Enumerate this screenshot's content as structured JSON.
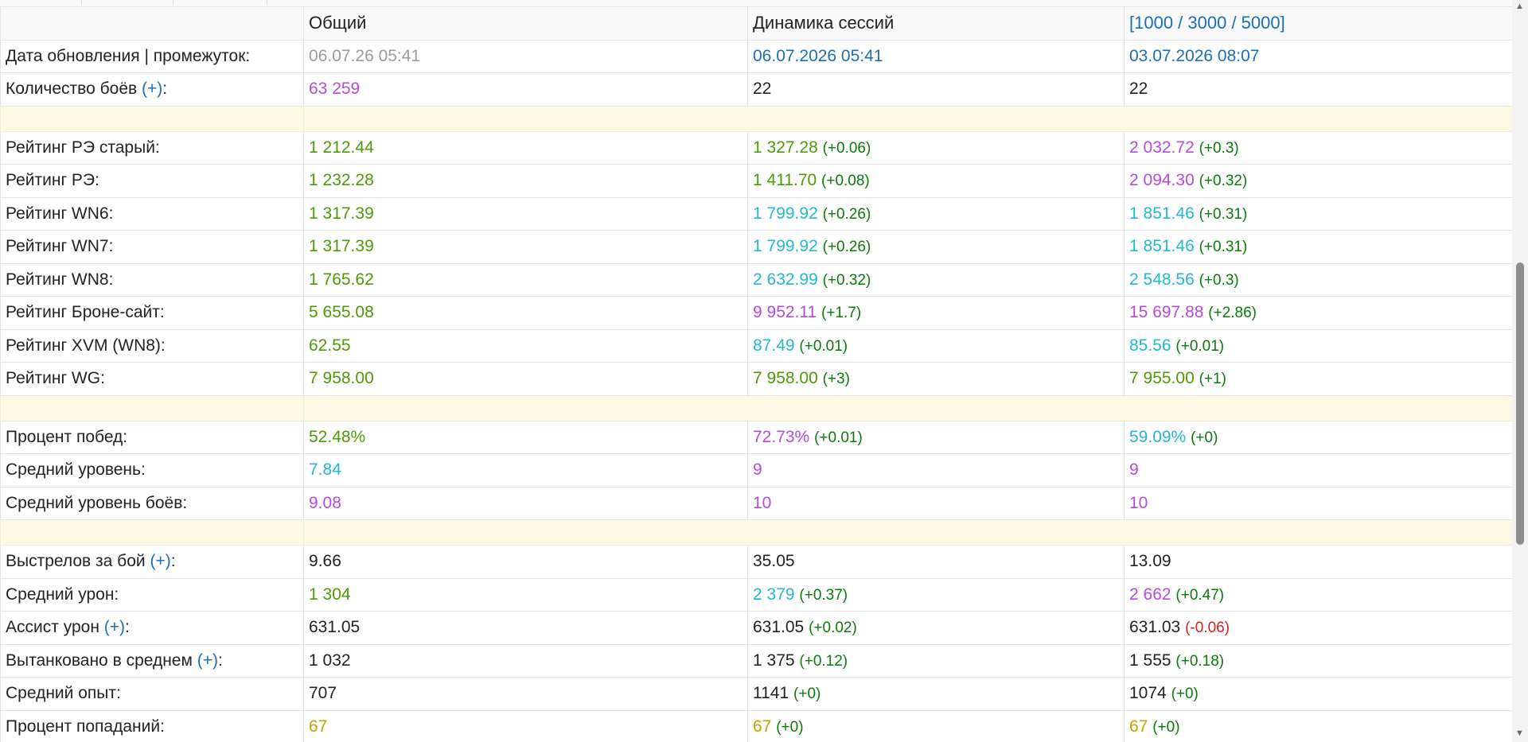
{
  "header": {
    "col_general": "Общий",
    "col_dynamics": "Динамика сессий",
    "col_ranges": "[1000 / 3000 / 5000]"
  },
  "update_row": {
    "label": "Дата обновления | промежуток:",
    "general": "06.07.26 05:41",
    "dynamics": "06.07.2026 05:41",
    "ranges": "03.07.2026 08:07"
  },
  "battles_row": {
    "label": "Количество боёв",
    "plus": "(+)",
    "colon": ":",
    "general": "63 259",
    "dynamics": "22",
    "ranges": "22"
  },
  "ratings": [
    {
      "label": "Рейтинг РЭ старый:",
      "general": "1 212.44",
      "general_color": "green",
      "dynamics": "1 327.28",
      "dynamics_color": "green",
      "dynamics_delta": "(+0.06)",
      "ranges": "2 032.72",
      "ranges_color": "purple",
      "ranges_delta": "(+0.3)"
    },
    {
      "label": "Рейтинг РЭ:",
      "general": "1 232.28",
      "general_color": "green",
      "dynamics": "1 411.70",
      "dynamics_color": "green",
      "dynamics_delta": "(+0.08)",
      "ranges": "2 094.30",
      "ranges_color": "purple",
      "ranges_delta": "(+0.32)"
    },
    {
      "label": "Рейтинг WN6:",
      "general": "1 317.39",
      "general_color": "green",
      "dynamics": "1 799.92",
      "dynamics_color": "cyan",
      "dynamics_delta": "(+0.26)",
      "ranges": "1 851.46",
      "ranges_color": "cyan",
      "ranges_delta": "(+0.31)"
    },
    {
      "label": "Рейтинг WN7:",
      "general": "1 317.39",
      "general_color": "green",
      "dynamics": "1 799.92",
      "dynamics_color": "cyan",
      "dynamics_delta": "(+0.26)",
      "ranges": "1 851.46",
      "ranges_color": "cyan",
      "ranges_delta": "(+0.31)"
    },
    {
      "label": "Рейтинг WN8:",
      "general": "1 765.62",
      "general_color": "green",
      "dynamics": "2 632.99",
      "dynamics_color": "cyan",
      "dynamics_delta": "(+0.32)",
      "ranges": "2 548.56",
      "ranges_color": "cyan",
      "ranges_delta": "(+0.3)"
    },
    {
      "label": "Рейтинг Броне-сайт:",
      "general": "5 655.08",
      "general_color": "green",
      "dynamics": "9 952.11",
      "dynamics_color": "purple",
      "dynamics_delta": "(+1.7)",
      "ranges": "15 697.88",
      "ranges_color": "purple",
      "ranges_delta": "(+2.86)"
    },
    {
      "label": "Рейтинг XVM (WN8):",
      "general": "62.55",
      "general_color": "green",
      "dynamics": "87.49",
      "dynamics_color": "cyan",
      "dynamics_delta": "(+0.01)",
      "ranges": "85.56",
      "ranges_color": "cyan",
      "ranges_delta": "(+0.01)"
    },
    {
      "label": "Рейтинг WG:",
      "general": "7 958.00",
      "general_color": "green",
      "dynamics": "7 958.00",
      "dynamics_color": "green",
      "dynamics_delta": "(+3)",
      "ranges": "7 955.00",
      "ranges_color": "green",
      "ranges_delta": "(+1)"
    }
  ],
  "performance": [
    {
      "label": "Процент побед:",
      "general": "52.48%",
      "general_color": "green",
      "dynamics": "72.73%",
      "dynamics_color": "purple",
      "dynamics_delta": "(+0.01)",
      "ranges": "59.09%",
      "ranges_color": "cyan",
      "ranges_delta": "(+0)"
    },
    {
      "label": "Средний уровень:",
      "general": "7.84",
      "general_color": "cyan",
      "dynamics": "9",
      "dynamics_color": "purple",
      "dynamics_delta": "",
      "ranges": "9",
      "ranges_color": "purple",
      "ranges_delta": ""
    },
    {
      "label": "Средний уровень боёв:",
      "general": "9.08",
      "general_color": "purple",
      "dynamics": "10",
      "dynamics_color": "purple",
      "dynamics_delta": "",
      "ranges": "10",
      "ranges_color": "purple",
      "ranges_delta": ""
    }
  ],
  "combat": [
    {
      "label": "Выстрелов за бой",
      "plus": "(+)",
      "colon": ":",
      "general": "9.66",
      "general_color": "default",
      "dynamics": "35.05",
      "dynamics_color": "default",
      "dynamics_delta": "",
      "ranges": "13.09",
      "ranges_color": "default",
      "ranges_delta": ""
    },
    {
      "label": "Средний урон:",
      "plus": "",
      "colon": "",
      "general": "1 304",
      "general_color": "green",
      "dynamics": "2 379",
      "dynamics_color": "cyan",
      "dynamics_delta": "(+0.37)",
      "ranges": "2 662",
      "ranges_color": "purple",
      "ranges_delta": "(+0.47)"
    },
    {
      "label": "Ассист урон",
      "plus": "(+)",
      "colon": ":",
      "general": "631.05",
      "general_color": "default",
      "dynamics": "631.05",
      "dynamics_color": "default",
      "dynamics_delta": "(+0.02)",
      "ranges": "631.03",
      "ranges_color": "default",
      "ranges_delta": "(-0.06)",
      "ranges_delta_neg": true
    },
    {
      "label": "Вытанковано в среднем",
      "plus": "(+)",
      "colon": ":",
      "general": "1 032",
      "general_color": "default",
      "dynamics": "1 375",
      "dynamics_color": "default",
      "dynamics_delta": "(+0.12)",
      "ranges": "1 555",
      "ranges_color": "default",
      "ranges_delta": "(+0.18)"
    },
    {
      "label": "Средний опыт:",
      "plus": "",
      "colon": "",
      "general": "707",
      "general_color": "default",
      "dynamics": "1141",
      "dynamics_color": "default",
      "dynamics_delta": "(+0)",
      "ranges": "1074",
      "ranges_color": "default",
      "ranges_delta": "(+0)"
    },
    {
      "label": "Процент попаданий:",
      "plus": "",
      "colon": "",
      "general": "67",
      "general_color": "yellow",
      "dynamics": "67",
      "dynamics_color": "yellow",
      "dynamics_delta": "(+0)",
      "ranges": "67",
      "ranges_color": "yellow",
      "ranges_delta": "(+0)"
    }
  ],
  "colors": {
    "green": "#4d9a06",
    "cyan": "#22b8cf",
    "purple": "#b54bdc",
    "blue_link": "#1a6fb8",
    "delta_positive": "#0a7a0a",
    "delta_negative": "#d42020",
    "spacer_bg": "#fef9e5"
  },
  "scrollbar": {
    "up_icon": "▲",
    "down_icon": "▼"
  }
}
